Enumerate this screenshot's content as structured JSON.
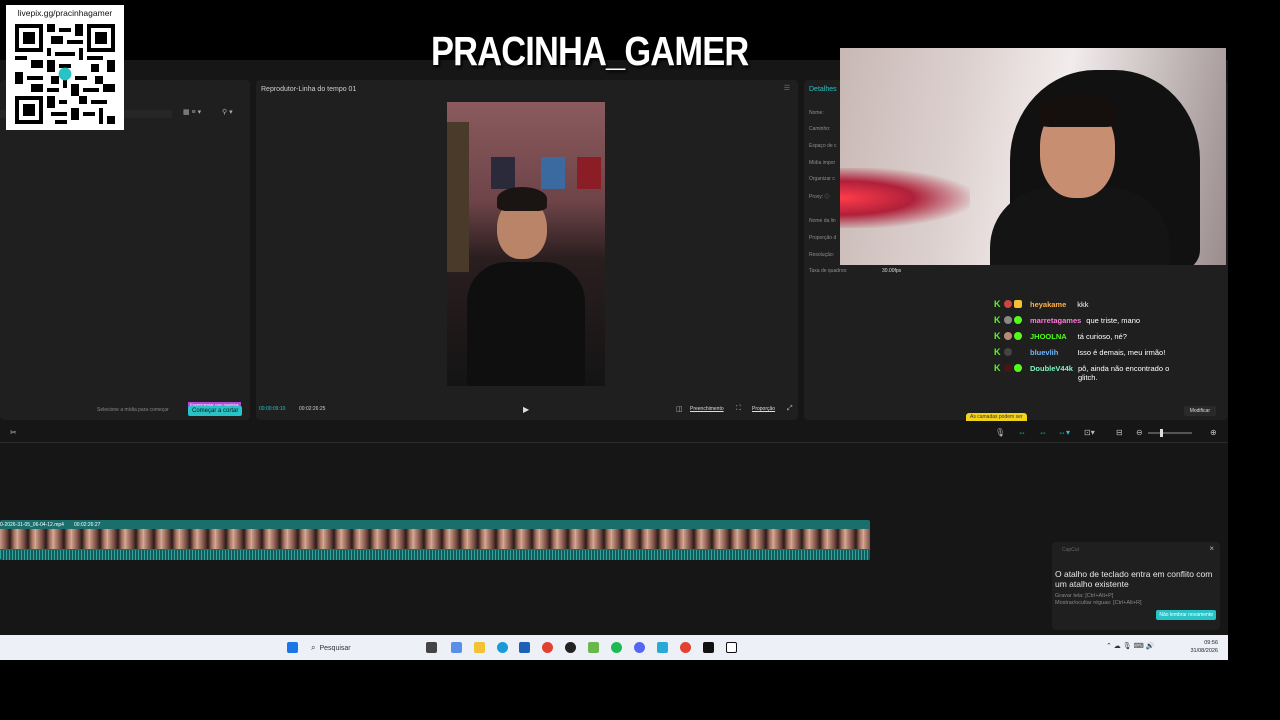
{
  "overlay": {
    "streamer_name": "PRACINHA_GAMER",
    "qr_url": "livepix.gg/pracinhagamer"
  },
  "media_panel": {
    "hint": "Selecione a mídia para começar",
    "experiment_badge": "Experimentar com modelos",
    "start_button": "Começar a cortar"
  },
  "player": {
    "title": "Reprodutor-Linha do tempo 01",
    "current_time": "00:00:09:10",
    "total_time": "00:02:26:25",
    "fill_label": "Preenchimento",
    "ratio_label": "Proporção"
  },
  "details": {
    "title": "Detalhes",
    "fields": [
      "Nome:",
      "Caminho:",
      "Espaço de c",
      "Mídia impor",
      "Organizar c",
      "Proxy: ⓘ",
      "Nome da lin",
      "Proporção d",
      "Resolução:",
      "Taxa de quadros:"
    ],
    "fps": "30.00fps",
    "warning": "As camadas podem ser",
    "modify_button": "Modificar"
  },
  "timeline": {
    "clip_name": "0-2026-31-05_06-04-12.mp4",
    "clip_duration": "00:02:26:27"
  },
  "notice": {
    "app": "CapCut",
    "title": "O atalho de teclado entra em conflito com um atalho existente",
    "line1": "Gravar tela: [Ctrl+Alt+P]",
    "line2": "Mostrar/ocultar réguas: [Ctrl+Alt+R]",
    "button": "Não lembrar novamente"
  },
  "taskbar": {
    "search_placeholder": "Pesquisar",
    "time": "09:56",
    "date": "31/08/2026"
  },
  "chat": [
    {
      "user": "heyakame",
      "color": "#ffb347",
      "message": "kkk"
    },
    {
      "user": "marretagames",
      "color": "#ff7ad9",
      "message": "que triste, mano"
    },
    {
      "user": "JHOOLNA",
      "color": "#53fc18",
      "message": "tá curioso, né?"
    },
    {
      "user": "bluevlih",
      "color": "#6eb6ff",
      "message": "Isso é demais, meu irmão!"
    },
    {
      "user": "DoubleV44k",
      "color": "#7cf9c4",
      "message": "pô, ainda não encontrado o glitch."
    }
  ]
}
